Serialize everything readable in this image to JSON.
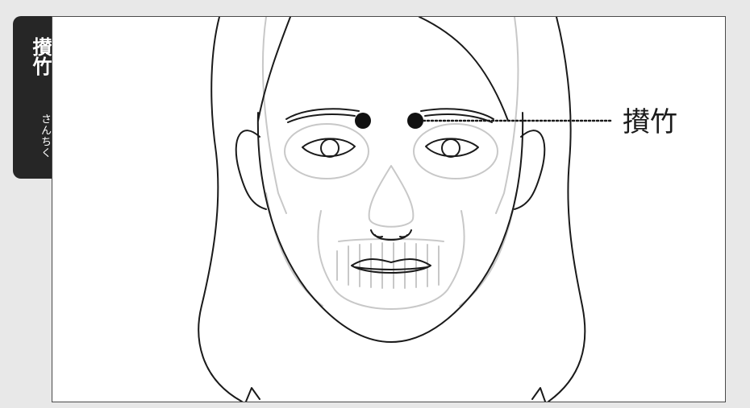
{
  "side_tab": {
    "kanji": "攅竹",
    "reading": "さんちく"
  },
  "point_label": "攅竹",
  "colors": {
    "page_bg": "#e8e8e8",
    "tab_bg": "#262626",
    "line": "#1a1a1a",
    "skull": "#c8c8c8",
    "point": "#111111"
  }
}
